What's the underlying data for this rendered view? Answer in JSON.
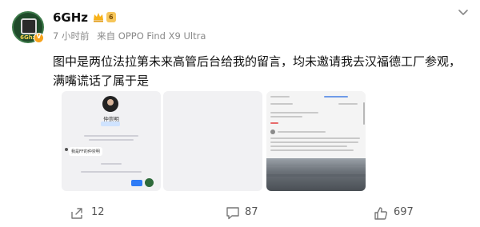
{
  "post": {
    "author": {
      "name": "6GHz",
      "avatar_text": "6Ghz",
      "badge_icon": "crown-icon",
      "vip_label": "6"
    },
    "meta": {
      "time": "7 小时前",
      "source": "来自 OPPO Find X9 Ultra"
    },
    "text": "图中是两位法拉第未来高管后台给我的留言，均未邀请我去汉福德工厂参观，满嘴谎话了属于是",
    "images": [
      {
        "name": "仲崇明",
        "bubble": "我是FF的仲崇明"
      },
      {},
      {}
    ],
    "actions": {
      "share_count": "12",
      "comment_count": "87",
      "like_count": "697"
    }
  },
  "colors": {
    "accent_blue": "#2f7cf6",
    "badge_orange": "#f7a21b",
    "vip_gold": "#f6c65a"
  }
}
